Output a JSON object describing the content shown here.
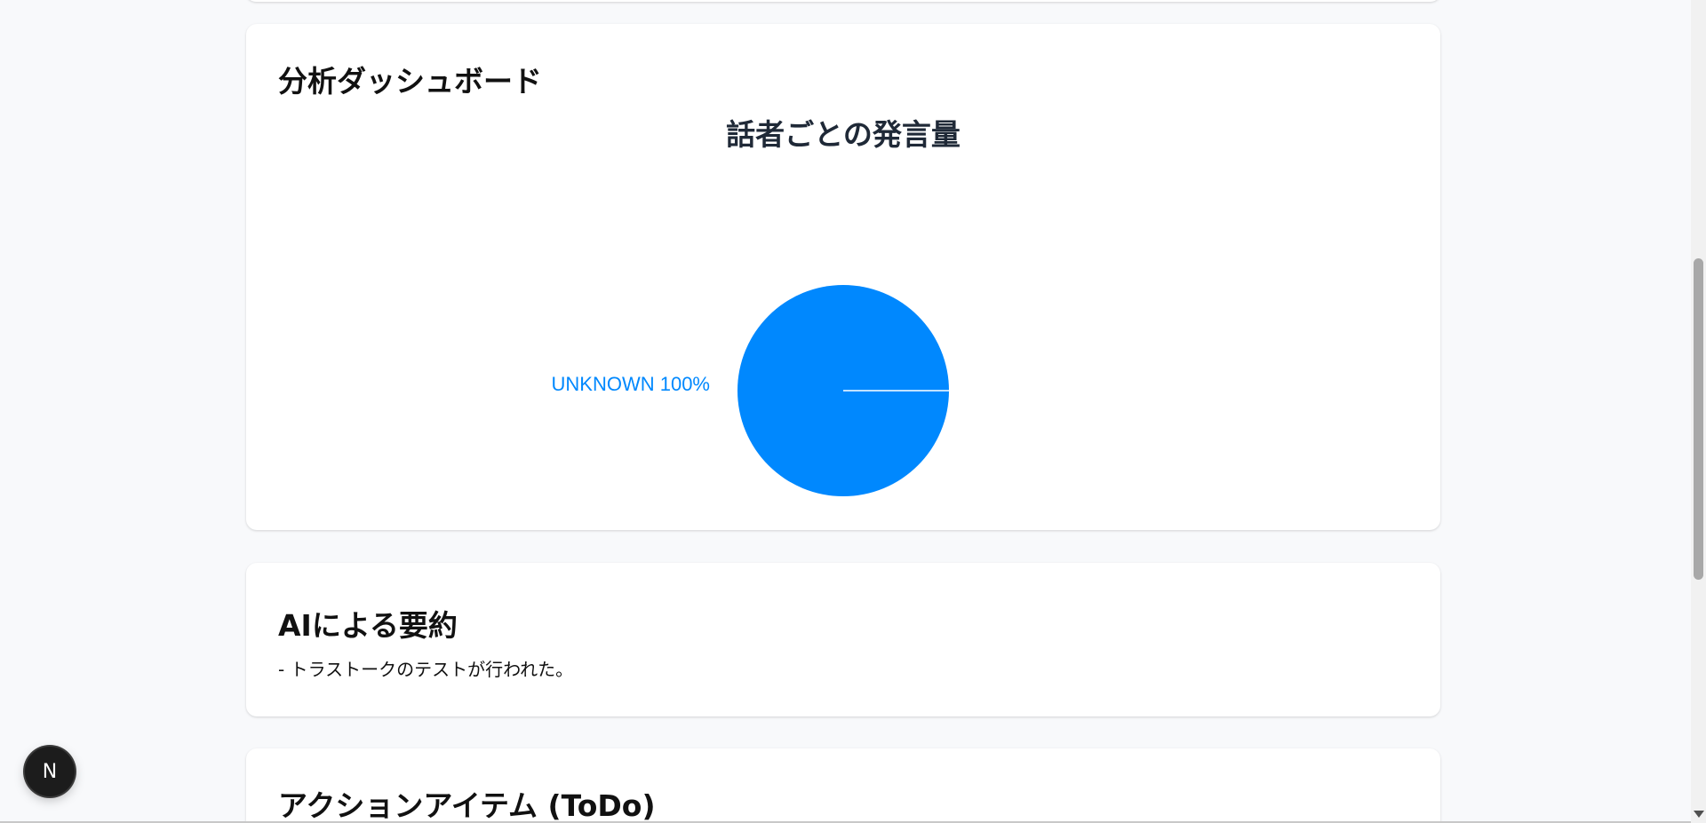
{
  "dashboard": {
    "title": "分析ダッシュボード"
  },
  "chart_data": {
    "type": "pie",
    "title": "話者ごとの発言量",
    "categories": [
      "UNKNOWN"
    ],
    "values": [
      100
    ],
    "labels": [
      "UNKNOWN 100%"
    ],
    "colors": [
      "#0088FE"
    ],
    "legend": "none"
  },
  "summary": {
    "title": "AIによる要約",
    "text": "- トラストークのテストが行われた。"
  },
  "todo": {
    "title": "アクションアイテム (ToDo)"
  },
  "next_badge": {
    "label": "N",
    "icon": "nextjs-logo-icon"
  }
}
